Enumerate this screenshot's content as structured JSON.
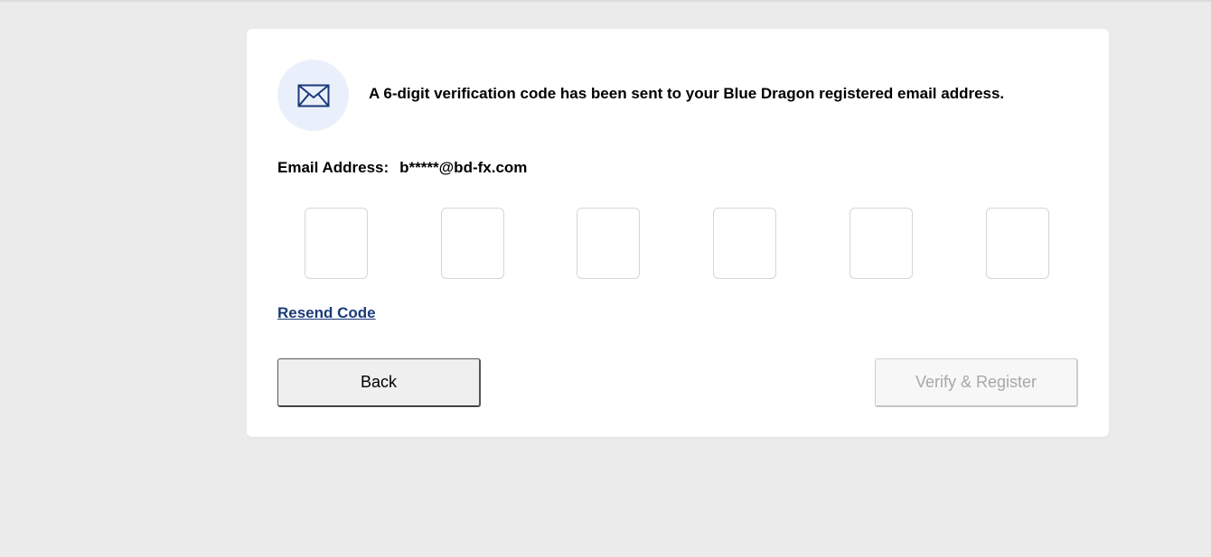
{
  "verification": {
    "notice": "A 6-digit verification code has been sent to your Blue Dragon registered email address.",
    "email_label": "Email Address:",
    "email_value": "b*****@bd-fx.com",
    "code_digits": [
      "",
      "",
      "",
      "",
      "",
      ""
    ],
    "resend_label": "Resend Code",
    "back_label": "Back",
    "verify_label": "Verify & Register",
    "verify_enabled": false
  },
  "colors": {
    "background": "#ebebeb",
    "card": "#ffffff",
    "icon_circle": "#eaf0fb",
    "icon_stroke": "#1a3a78",
    "link": "#1a3a78",
    "disabled_text": "#a8a8a8"
  },
  "icons": {
    "notice_icon": "envelope-icon"
  }
}
